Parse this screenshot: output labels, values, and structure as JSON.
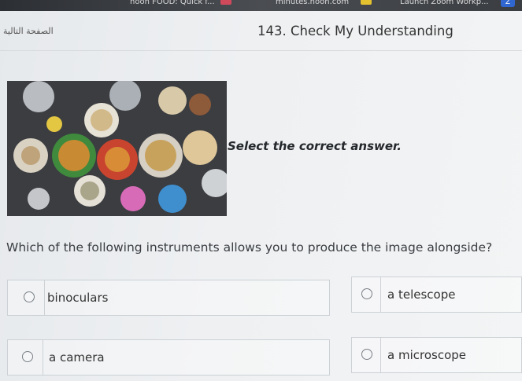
{
  "browser": {
    "tab1": "noon FOOD: Quick f...",
    "tab2": "minutes.noon.com",
    "tab3": "Launch Zoom Workp..."
  },
  "header": {
    "arabic_label": "الصفحة التالية",
    "title": "143. Check My Understanding"
  },
  "instruction": "Select the correct answer.",
  "question": "Which of the following instruments allows you to produce the image alongside?",
  "options": [
    {
      "label": "binoculars"
    },
    {
      "label": "a telescope"
    },
    {
      "label": "a camera"
    },
    {
      "label": "a microscope"
    }
  ],
  "colors": {
    "accent_chip_red": "#d14a5c",
    "accent_chip_yellow": "#e4c12e",
    "zoom_blue": "#2f66d0"
  }
}
